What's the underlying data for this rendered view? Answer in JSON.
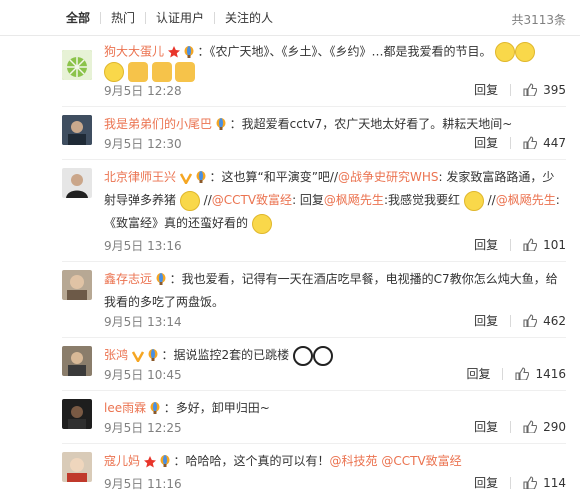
{
  "tabs": [
    {
      "label": "全部",
      "active": true
    },
    {
      "label": "热门"
    },
    {
      "label": "认证用户"
    },
    {
      "label": "关注的人"
    }
  ],
  "total_count": "共3113条",
  "reply_label": "回复",
  "colors": {
    "accent": "#eb7350",
    "meta": "#808080"
  },
  "comments": [
    {
      "username": "狗大大蛋儿",
      "text": "：《农广天地》、《乡土》、《乡约》…都是我爱看的节目。",
      "time": "9月5日 12:28",
      "likes": "395"
    },
    {
      "username": "我是弟弟们的小尾巴",
      "text": "：我超爱看cctv7，农广天地太好看了。耕耘天地间~",
      "time": "9月5日 12:30",
      "likes": "447"
    },
    {
      "username": "北京律师王兴",
      "text_a": "：这也算“和平演变”吧//",
      "mention_a": "@战争史研究WHS",
      "text_b": ": 发家致富路路通，少射导弹多养猪",
      "text_c": " //",
      "mention_b": "@CCTV致富经",
      "text_d": ": 回复",
      "mention_c": "@枫飏先生",
      "text_e": ":我感觉我要红",
      "text_f": " //",
      "mention_d": "@枫飏先生",
      "text_g": ":《致富经》真的还蛮好看的",
      "time": "9月5日 13:16",
      "likes": "101"
    },
    {
      "username": "鑫存志远",
      "text": "：我也爱看，记得有一天在酒店吃早餐，电视播的C7教你怎么炖大鱼，给我看的多吃了两盘饭。",
      "time": "9月5日 13:14",
      "likes": "462"
    },
    {
      "username": "张鸿",
      "text": "：据说监控2套的已跳楼",
      "time": "9月5日 10:45",
      "likes": "1416"
    },
    {
      "username": "lee雨霖",
      "text": "：多好，卸甲归田~",
      "time": "9月5日 12:25",
      "likes": "290"
    },
    {
      "username": "寇儿妈",
      "text": "：哈哈哈，这个真的可以有！",
      "mention_a": "@科技苑",
      "mention_b": "@CCTV致富经",
      "time": "9月5日 11:16",
      "likes": "114"
    }
  ]
}
